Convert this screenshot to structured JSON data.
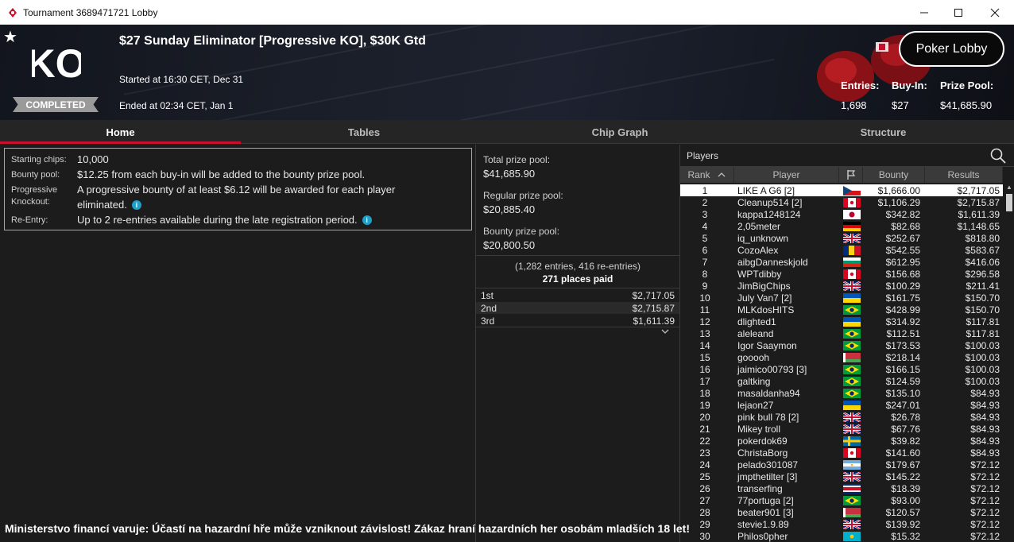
{
  "window": {
    "title": "Tournament 3689471721 Lobby"
  },
  "header": {
    "badge_text": "KO",
    "status": "COMPLETED",
    "tournament_name": "$27 Sunday Eliminator [Progressive KO], $30K Gtd",
    "started": "Started at 16:30 CET, Dec 31",
    "ended": "Ended at 02:34 CET, Jan 1",
    "poker_lobby_label": "Poker Lobby",
    "entries_label": "Entries:",
    "entries_value": "1,698",
    "buyin_label": "Buy-In:",
    "buyin_value": "$27",
    "prizepool_label": "Prize Pool:",
    "prizepool_value": "$41,685.90"
  },
  "tabs": [
    {
      "label": "Home",
      "active": true
    },
    {
      "label": "Tables",
      "active": false
    },
    {
      "label": "Chip Graph",
      "active": false
    },
    {
      "label": "Structure",
      "active": false
    }
  ],
  "info": {
    "starting_chips_label": "Starting chips:",
    "starting_chips_value": "10,000",
    "bounty_pool_label": "Bounty pool:",
    "bounty_pool_value": "$12.25 from each buy-in will be added to the bounty prize pool.",
    "progressive_label_1": "Progressive",
    "progressive_label_2": "Knockout:",
    "progressive_value_1": "A progressive bounty of at least $6.12 will be awarded for each player",
    "progressive_value_2": "eliminated.",
    "reentry_label": "Re-Entry:",
    "reentry_value": "Up to 2 re-entries available during the late registration period."
  },
  "prize": {
    "total_label": "Total prize pool:",
    "total_value": "$41,685.90",
    "regular_label": "Regular prize pool:",
    "regular_value": "$20,885.40",
    "bounty_label": "Bounty prize pool:",
    "bounty_value": "$20,800.50",
    "entries_text": "(1,282 entries, 416 re-entries)",
    "places_paid": "271 places paid",
    "payouts": [
      {
        "place": "1st",
        "amount": "$2,717.05"
      },
      {
        "place": "2nd",
        "amount": "$2,715.87"
      },
      {
        "place": "3rd",
        "amount": "$1,611.39"
      }
    ]
  },
  "players": {
    "title": "Players",
    "columns": {
      "rank": "Rank",
      "player": "Player",
      "bounty": "Bounty",
      "results": "Results"
    },
    "rows": [
      {
        "rank": "1",
        "name": "LIKE A G6 [2]",
        "flag": "cz",
        "bounty": "$1,666.00",
        "result": "$2,717.05"
      },
      {
        "rank": "2",
        "name": "Cleanup514 [2]",
        "flag": "ca",
        "bounty": "$1,106.29",
        "result": "$2,715.87"
      },
      {
        "rank": "3",
        "name": "kappa1248124",
        "flag": "jp",
        "bounty": "$342.82",
        "result": "$1,611.39"
      },
      {
        "rank": "4",
        "name": "2,05meter",
        "flag": "de",
        "bounty": "$82.68",
        "result": "$1,148.65"
      },
      {
        "rank": "5",
        "name": "iq_unknown",
        "flag": "gb",
        "bounty": "$252.67",
        "result": "$818.80"
      },
      {
        "rank": "6",
        "name": "CozoAlex",
        "flag": "ro",
        "bounty": "$542.55",
        "result": "$583.67"
      },
      {
        "rank": "7",
        "name": "aibgDanneskjold",
        "flag": "bg",
        "bounty": "$612.95",
        "result": "$416.06"
      },
      {
        "rank": "8",
        "name": "WPTdibby",
        "flag": "ca",
        "bounty": "$156.68",
        "result": "$296.58"
      },
      {
        "rank": "9",
        "name": "JimBigChips",
        "flag": "gb",
        "bounty": "$100.29",
        "result": "$211.41"
      },
      {
        "rank": "10",
        "name": "July Van7 [2]",
        "flag": "ua",
        "bounty": "$161.75",
        "result": "$150.70"
      },
      {
        "rank": "11",
        "name": "MLKdosHITS",
        "flag": "br",
        "bounty": "$428.99",
        "result": "$150.70"
      },
      {
        "rank": "12",
        "name": "dlighted1",
        "flag": "ua",
        "bounty": "$314.92",
        "result": "$117.81"
      },
      {
        "rank": "13",
        "name": "aleleand",
        "flag": "br",
        "bounty": "$112.51",
        "result": "$117.81"
      },
      {
        "rank": "14",
        "name": "Igor Saaymon",
        "flag": "br",
        "bounty": "$173.53",
        "result": "$100.03"
      },
      {
        "rank": "15",
        "name": "gooooh",
        "flag": "by",
        "bounty": "$218.14",
        "result": "$100.03"
      },
      {
        "rank": "16",
        "name": "jaimico00793 [3]",
        "flag": "br",
        "bounty": "$166.15",
        "result": "$100.03"
      },
      {
        "rank": "17",
        "name": "galtking",
        "flag": "br",
        "bounty": "$124.59",
        "result": "$100.03"
      },
      {
        "rank": "18",
        "name": "masaldanha94",
        "flag": "br",
        "bounty": "$135.10",
        "result": "$84.93"
      },
      {
        "rank": "19",
        "name": "lejaon27",
        "flag": "ua",
        "bounty": "$247.01",
        "result": "$84.93"
      },
      {
        "rank": "20",
        "name": "pink bull 78 [2]",
        "flag": "gb",
        "bounty": "$26.78",
        "result": "$84.93"
      },
      {
        "rank": "21",
        "name": "Mikey troll",
        "flag": "gb",
        "bounty": "$67.76",
        "result": "$84.93"
      },
      {
        "rank": "22",
        "name": "pokerdok69",
        "flag": "se",
        "bounty": "$39.82",
        "result": "$84.93"
      },
      {
        "rank": "23",
        "name": "ChristaBorg",
        "flag": "ca",
        "bounty": "$141.60",
        "result": "$84.93"
      },
      {
        "rank": "24",
        "name": "pelado301087",
        "flag": "ar",
        "bounty": "$179.67",
        "result": "$72.12"
      },
      {
        "rank": "25",
        "name": "jmpthetilter [3]",
        "flag": "gb",
        "bounty": "$145.22",
        "result": "$72.12"
      },
      {
        "rank": "26",
        "name": "transerfing",
        "flag": "cr",
        "bounty": "$18.39",
        "result": "$72.12"
      },
      {
        "rank": "27",
        "name": "77portuga [2]",
        "flag": "br",
        "bounty": "$93.00",
        "result": "$72.12"
      },
      {
        "rank": "28",
        "name": "beater901 [3]",
        "flag": "by",
        "bounty": "$120.57",
        "result": "$72.12"
      },
      {
        "rank": "29",
        "name": "stevie1.9.89",
        "flag": "gb",
        "bounty": "$139.92",
        "result": "$72.12"
      },
      {
        "rank": "30",
        "name": "Philos0pher",
        "flag": "kz",
        "bounty": "$15.32",
        "result": "$72.12"
      }
    ]
  },
  "warning": "Ministerstvo financí varuje: Účastí na hazardní hře může vzniknout závislost! Zákaz hraní hazardních her osobám mladších 18 let!",
  "colors": {
    "accent": "#c8102e",
    "info_icon": "#1ea0c8",
    "completed_badge": "#9a9a9a"
  }
}
